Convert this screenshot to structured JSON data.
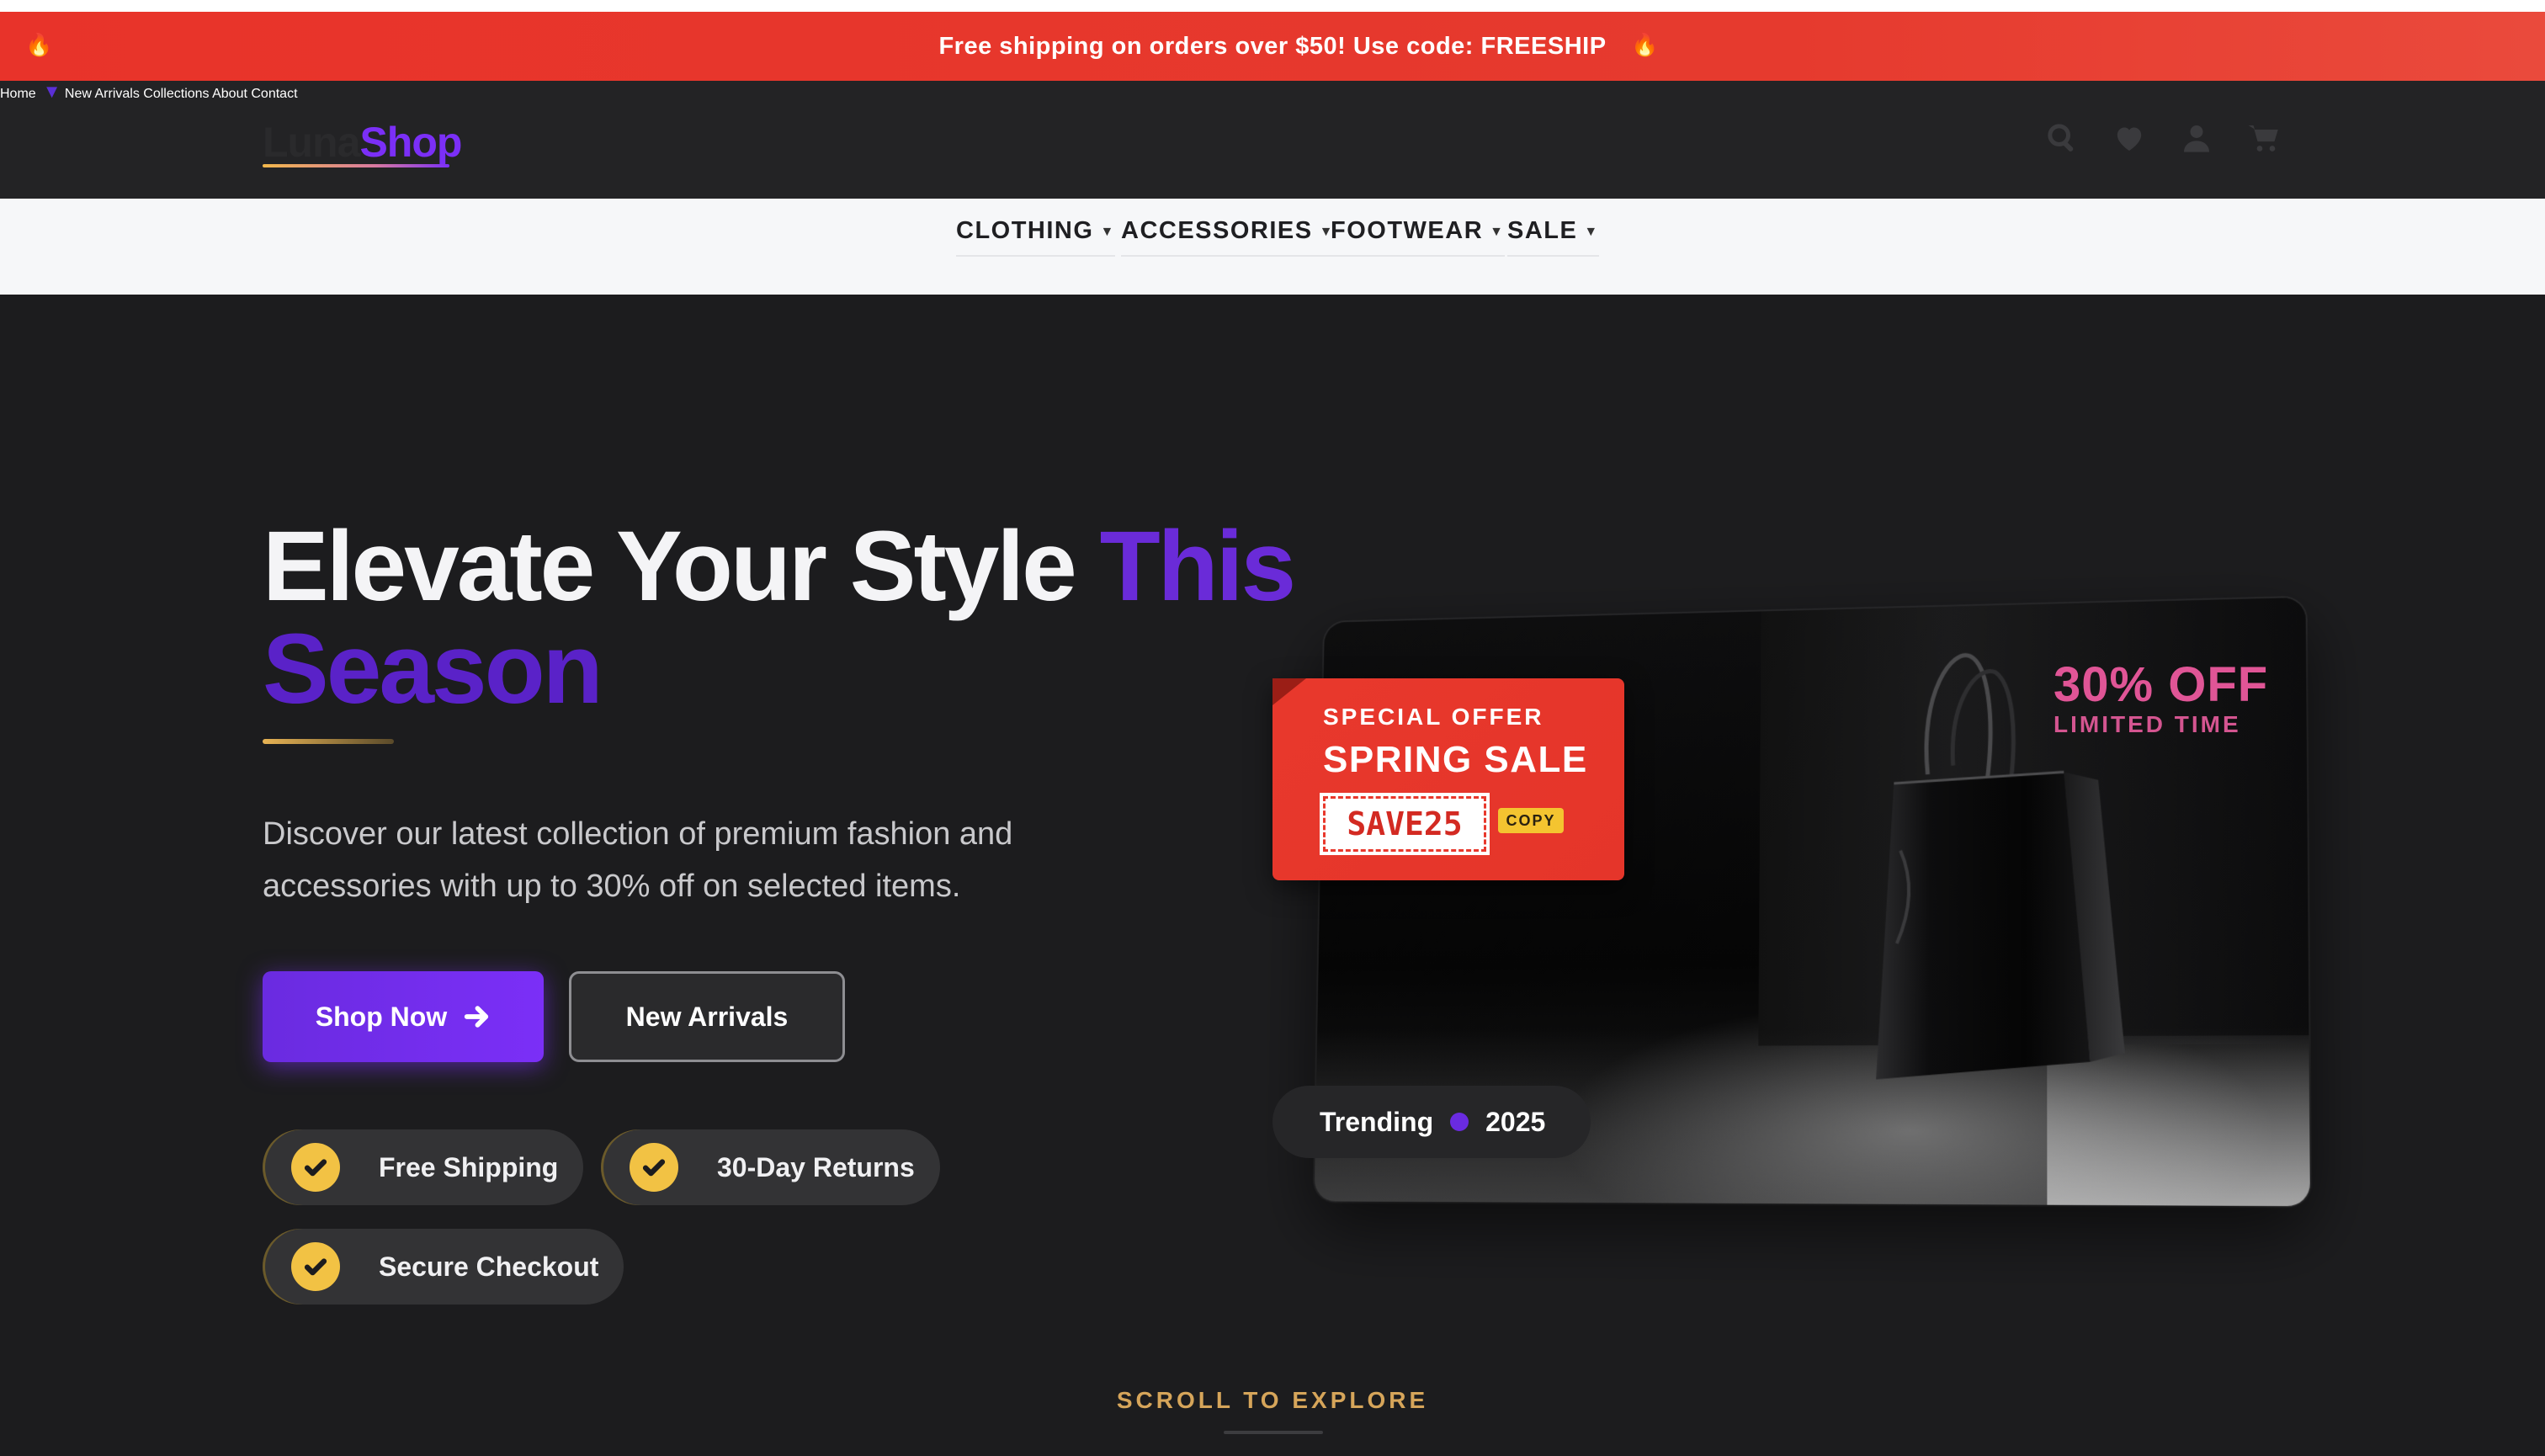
{
  "promo": {
    "text": "Free shipping on orders over $50! Use code: FREESHIP",
    "icon_left": "flame-icon",
    "icon_right": "flame-icon",
    "background": "#e8332a"
  },
  "header": {
    "logo_part1": "Luna",
    "logo_part2": "Shop",
    "nav": [
      {
        "label": "Home",
        "active": true
      },
      {
        "label": "New Arrivals"
      },
      {
        "label": "Collections"
      },
      {
        "label": "About"
      },
      {
        "label": "Contact"
      }
    ],
    "icons": [
      "search-icon",
      "heart-icon",
      "user-icon",
      "cart-icon"
    ]
  },
  "categories": [
    {
      "label": "CLOTHING"
    },
    {
      "label": "ACCESSORIES"
    },
    {
      "label": "FOOTWEAR"
    },
    {
      "label": "SALE"
    }
  ],
  "hero": {
    "title_white": "Elevate Your Style",
    "title_purple1": "This",
    "title_purple2": "Season",
    "description": "Discover our latest collection of premium fashion and accessories with up to 30% off on selected items.",
    "primary_button": "Shop Now",
    "secondary_button": "New Arrivals",
    "features": [
      "Free Shipping",
      "30-Day Returns",
      "Secure Checkout"
    ]
  },
  "promo_card": {
    "special_offer": "SPECIAL OFFER",
    "sale_title": "SPRING SALE",
    "code": "SAVE25",
    "copy_label": "COPY",
    "discount": "30% OFF",
    "limited": "LIMITED TIME",
    "trend_label": "Trending",
    "trend_year": "2025"
  },
  "scroll_label": "SCROLL TO EXPLORE",
  "colors": {
    "accent": "#7b2ff7",
    "background": "#1c1c1e",
    "gold": "#f2c244",
    "pink": "#e05596"
  }
}
